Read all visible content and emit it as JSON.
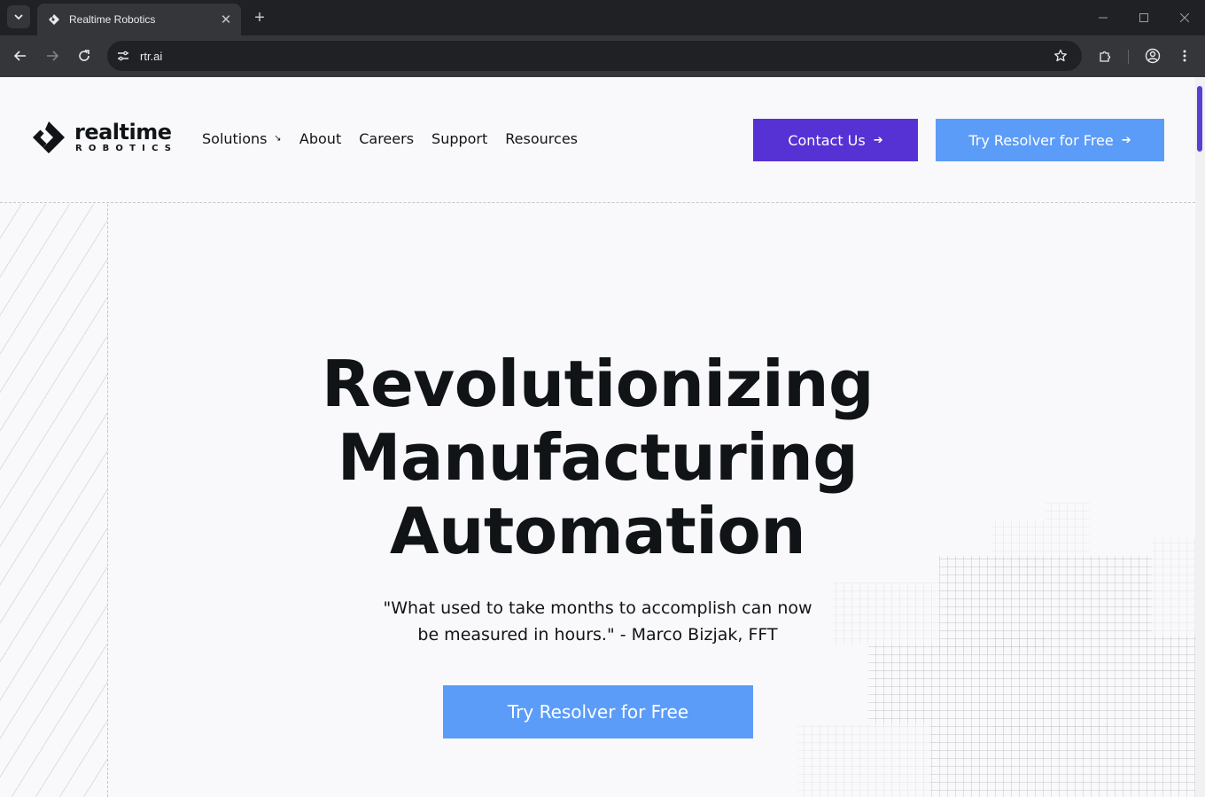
{
  "browser": {
    "tab_title": "Realtime Robotics",
    "url": "rtr.ai",
    "icons": {
      "tab_search": "chevron-down-icon",
      "close_tab": "close-icon",
      "new_tab": "plus-icon",
      "back": "arrow-left-icon",
      "forward": "arrow-right-icon",
      "reload": "reload-icon",
      "site_info": "tune-icon",
      "bookmark": "star-icon",
      "extensions": "puzzle-icon",
      "profile": "account-icon",
      "menu": "kebab-menu-icon"
    }
  },
  "logo": {
    "main": "realtime",
    "sub": "ROBOTICS"
  },
  "nav": {
    "items": [
      {
        "label": "Solutions",
        "has_dropdown": true
      },
      {
        "label": "About"
      },
      {
        "label": "Careers"
      },
      {
        "label": "Support"
      },
      {
        "label": "Resources"
      }
    ]
  },
  "header_buttons": {
    "contact": "Contact Us",
    "try": "Try Resolver for Free"
  },
  "hero": {
    "title_lines": [
      "Revolutionizing",
      "Manufacturing",
      "Automation"
    ],
    "quote_line1": "\"What used to take months to accomplish can now",
    "quote_line2": "be measured in hours.\" - Marco Bizjak, FFT",
    "cta": "Try Resolver for Free"
  },
  "colors": {
    "primary_purple": "#5632d4",
    "accent_blue": "#5b9cf8",
    "text_dark": "#111417",
    "page_bg": "#f9f9fc"
  }
}
